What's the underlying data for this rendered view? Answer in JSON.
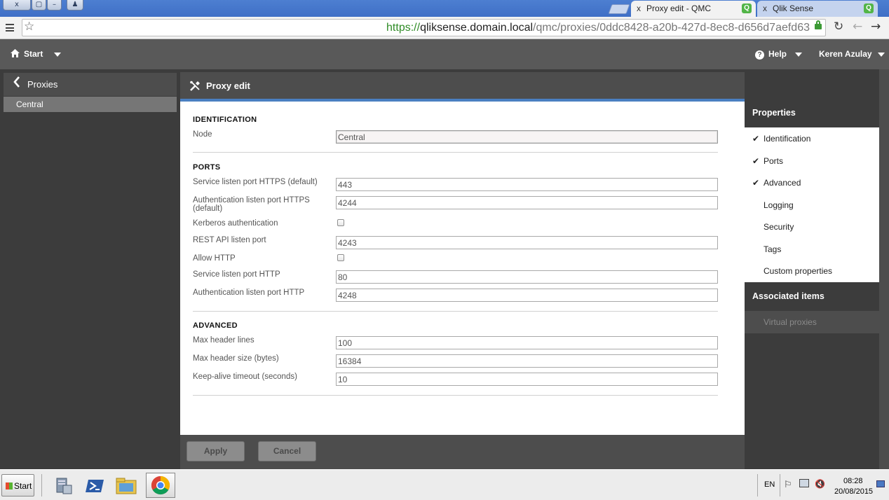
{
  "browser": {
    "window_buttons": [
      "x",
      "▢",
      "–",
      "♟"
    ],
    "tabs": [
      {
        "label": "Proxy edit - QMC",
        "close": "x",
        "icon": "qlik-icon",
        "active": true
      },
      {
        "label": "Qlik Sense",
        "close": "x",
        "icon": "qlik-icon",
        "active": false
      }
    ],
    "url": {
      "scheme": "https://",
      "host": "qliksense.domain.local",
      "path": "/qmc/proxies/0ddc8428-a20b-427d-8ec8-d656d7aefd63"
    }
  },
  "qmc_header": {
    "start_label": "Start",
    "help_label": "Help",
    "user_label": "Keren Azulay"
  },
  "left_nav": {
    "back_label": "Proxies",
    "items": [
      {
        "label": "Central",
        "selected": true
      }
    ]
  },
  "main": {
    "title": "Proxy edit",
    "sections": {
      "identification": {
        "heading": "IDENTIFICATION",
        "node_label": "Node",
        "node_value": "Central"
      },
      "ports": {
        "heading": "PORTS",
        "service_https_label": "Service listen port HTTPS (default)",
        "service_https_value": "443",
        "auth_https_label": "Authentication listen port HTTPS (default)",
        "auth_https_value": "4244",
        "kerberos_label": "Kerberos authentication",
        "kerberos_checked": false,
        "rest_api_label": "REST API listen port",
        "rest_api_value": "4243",
        "allow_http_label": "Allow HTTP",
        "allow_http_checked": false,
        "service_http_label": "Service listen port HTTP",
        "service_http_value": "80",
        "auth_http_label": "Authentication listen port HTTP",
        "auth_http_value": "4248"
      },
      "advanced": {
        "heading": "ADVANCED",
        "max_header_lines_label": "Max header lines",
        "max_header_lines_value": "100",
        "max_header_size_label": "Max header size (bytes)",
        "max_header_size_value": "16384",
        "keep_alive_label": "Keep-alive timeout (seconds)",
        "keep_alive_value": "10"
      }
    },
    "apply_label": "Apply",
    "cancel_label": "Cancel"
  },
  "properties_panel": {
    "heading": "Properties",
    "items": [
      {
        "label": "Identification",
        "checked": true
      },
      {
        "label": "Ports",
        "checked": true
      },
      {
        "label": "Advanced",
        "checked": true
      },
      {
        "label": "Logging",
        "checked": false
      },
      {
        "label": "Security",
        "checked": false
      },
      {
        "label": "Tags",
        "checked": false
      },
      {
        "label": "Custom properties",
        "checked": false
      }
    ],
    "associated_heading": "Associated items",
    "associated_items": [
      {
        "label": "Virtual proxies",
        "enabled": false
      }
    ]
  },
  "taskbar": {
    "start_label": "Start",
    "language": "EN",
    "time": "08:28",
    "date": "20/08/2015"
  },
  "colors": {
    "accent": "#4a7fc1",
    "header_bg": "#595959",
    "panel_dark": "#3c3c3c",
    "qlik_green": "#52b548"
  }
}
